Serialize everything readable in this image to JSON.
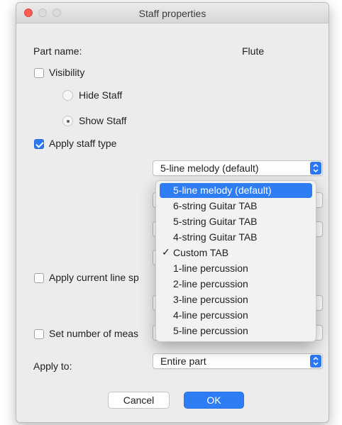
{
  "window": {
    "title": "Staff properties"
  },
  "part": {
    "label": "Part name:",
    "value": "Flute"
  },
  "visibility": {
    "label": "Visibility",
    "checked": false
  },
  "hide_staff": {
    "label": "Hide Staff",
    "selected": false
  },
  "show_staff": {
    "label": "Show Staff",
    "selected": true
  },
  "apply_staff_type": {
    "label": "Apply staff type",
    "checked": true,
    "selected_value": "5-line melody (default)"
  },
  "staff_type_menu": {
    "items": [
      {
        "label": "5-line melody (default)",
        "highlighted": true,
        "checked": false
      },
      {
        "label": "6-string Guitar TAB",
        "highlighted": false,
        "checked": false
      },
      {
        "label": "5-string Guitar TAB",
        "highlighted": false,
        "checked": false
      },
      {
        "label": "4-string Guitar TAB",
        "highlighted": false,
        "checked": false
      },
      {
        "label": "Custom TAB",
        "highlighted": false,
        "checked": true,
        "check_glyph": "✓"
      },
      {
        "label": "1-line percussion",
        "highlighted": false,
        "checked": false
      },
      {
        "label": "2-line percussion",
        "highlighted": false,
        "checked": false
      },
      {
        "label": "3-line percussion",
        "highlighted": false,
        "checked": false
      },
      {
        "label": "4-line percussion",
        "highlighted": false,
        "checked": false
      },
      {
        "label": "5-line percussion",
        "highlighted": false,
        "checked": false
      }
    ]
  },
  "apply_line_spacing": {
    "label": "Apply current line sp",
    "checked": false
  },
  "set_measures": {
    "label": "Set number of meas",
    "checked": false
  },
  "apply_to": {
    "label": "Apply to:",
    "value": "Entire part"
  },
  "buttons": {
    "cancel": "Cancel",
    "ok": "OK"
  },
  "colors": {
    "accent": "#2f7df5",
    "close_light": "#ff5f57",
    "window_bg": "#ececec"
  }
}
